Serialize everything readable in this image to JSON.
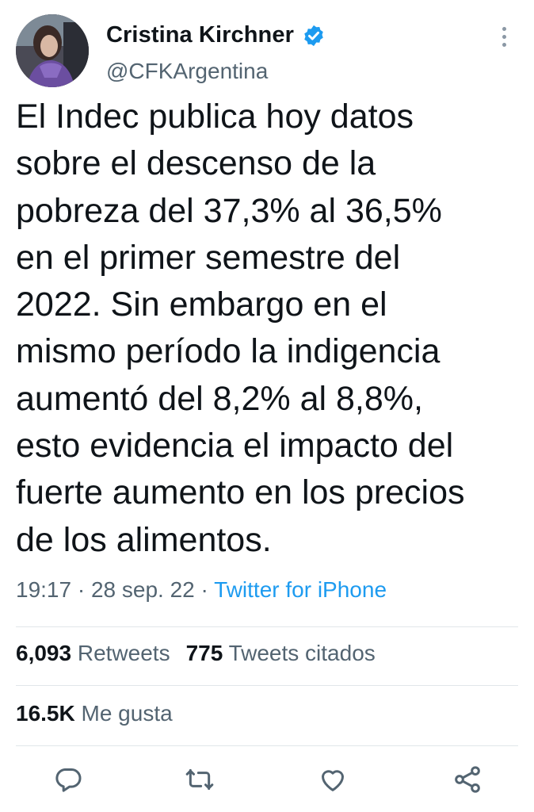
{
  "author": {
    "name": "Cristina Kirchner",
    "handle": "@CFKArgentina"
  },
  "tweet": {
    "text": "El Indec publica hoy datos\nsobre el descenso de la\npobreza del 37,3% al 36,5%\nen el primer semestre del\n2022. Sin embargo en el\nmismo período la indigencia\naumentó del 8,2% al 8,8%,\nesto evidencia el impacto del\nfuerte aumento en los precios\nde los alimentos."
  },
  "meta": {
    "time": "19:17",
    "separator1": " · ",
    "date": "28 sep. 22",
    "separator2": " · ",
    "source": "Twitter for iPhone"
  },
  "stats": {
    "retweets_count": "6,093",
    "retweets_label": "Retweets",
    "quotes_count": "775",
    "quotes_label": "Tweets citados",
    "likes_count": "16.5K",
    "likes_label": "Me gusta"
  },
  "colors": {
    "accent": "#1d9bf0",
    "secondary_text": "#536471",
    "primary_text": "#0f1419",
    "divider": "#e1e6ea"
  },
  "icons": {
    "verified": "verified-badge-icon",
    "more": "more-vertical-icon",
    "reply": "reply-icon",
    "retweet": "retweet-icon",
    "like": "heart-icon",
    "share": "share-icon"
  }
}
